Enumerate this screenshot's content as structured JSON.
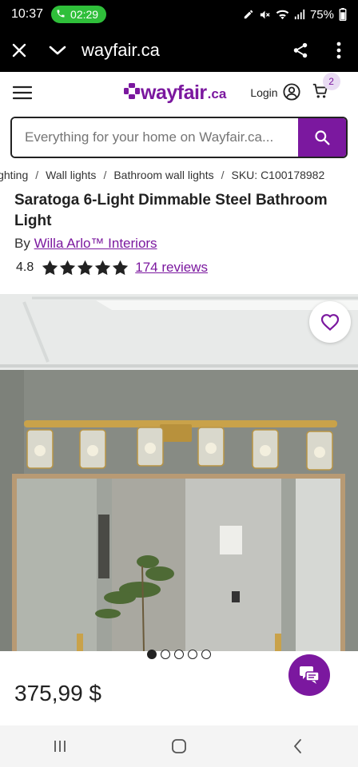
{
  "status_bar": {
    "time": "10:37",
    "call_timer": "02:29",
    "battery": "75%"
  },
  "browser": {
    "url": "wayfair.ca"
  },
  "header": {
    "logo_word": "wayfair",
    "logo_suffix": ".ca",
    "login_label": "Login",
    "cart_count": "2"
  },
  "search": {
    "placeholder": "Everything for your home on Wayfair.ca..."
  },
  "breadcrumb": {
    "items": [
      "ighting",
      "Wall lights",
      "Bathroom wall lights",
      "SKU: C100178982"
    ]
  },
  "product": {
    "title": "Saratoga 6-Light Dimmable Steel Bathroom Light",
    "by_prefix": "By",
    "brand": "Willa Arlo™ Interiors",
    "rating": "4.8",
    "reviews": "174 reviews",
    "price": "375,99 $",
    "image_count": 5,
    "active_image": 1
  },
  "colors": {
    "brand": "#7b189f",
    "status_green": "#2fbf3a"
  },
  "icons": [
    "close-icon",
    "chevron-down-icon",
    "share-icon",
    "more-vert-icon",
    "menu-icon",
    "account-icon",
    "cart-icon",
    "search-icon",
    "heart-icon",
    "chat-icon",
    "recents-icon",
    "home-icon",
    "back-icon"
  ]
}
